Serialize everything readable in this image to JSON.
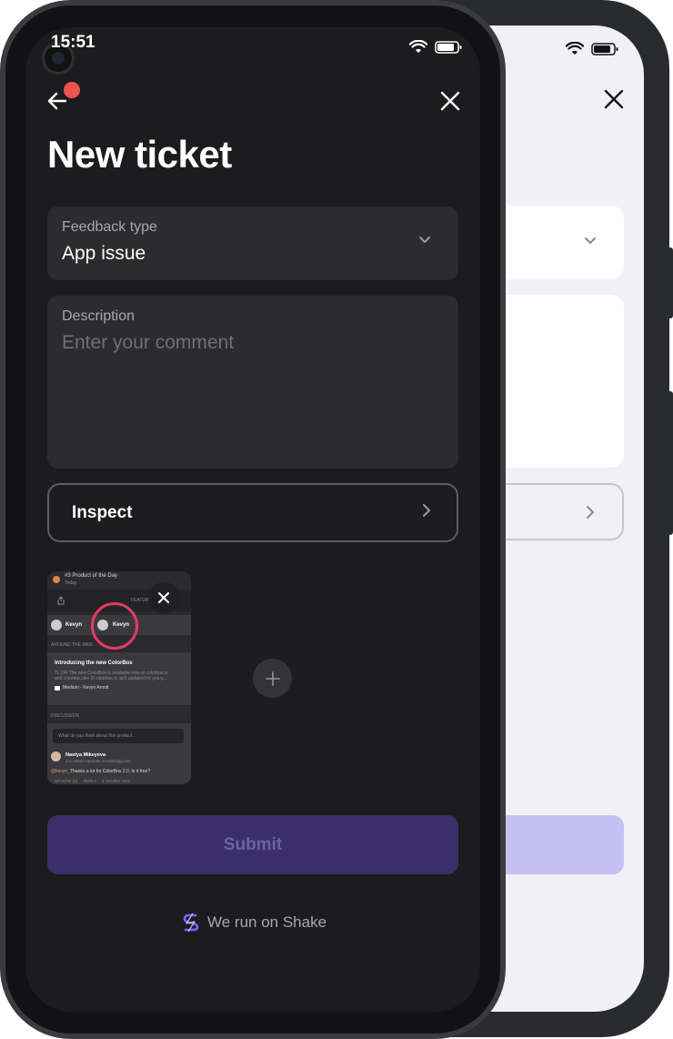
{
  "status": {
    "time": "15:51"
  },
  "header": {
    "title": "New ticket",
    "has_notification": true
  },
  "feedback_type": {
    "label": "Feedback type",
    "value": "App issue"
  },
  "description": {
    "label": "Description",
    "placeholder": "Enter your comment"
  },
  "inspect": {
    "label": "Inspect"
  },
  "attachment": {
    "product_rank": "#3 Product of the Day",
    "date": "Today",
    "featured_label": "FEATURED",
    "users": [
      "Kevyn",
      "Kevyn"
    ],
    "section_web": "AROUND THE WEB",
    "article_title": "Introducing the new ColorBox",
    "article_body_1": "TL;DR The new ColorBox is available now at colorbox.io",
    "article_body_2": "and colorbox.dev (if colorbox.io isn't updated for you y...",
    "article_source": "Medium - Kevyn Arnott",
    "section_discussion": "DISCUSSION",
    "discussion_placeholder": "What do you think about this product...",
    "commenter": "Nastya Mikeyeva",
    "commenter_role": "A Content marketer at Hashtag.com",
    "mention": "@kevyn_",
    "comment": "Thanks a lot for ColorBox 2.0. Is it free?",
    "actions": [
      "UPVOTE (1)",
      "REPLY",
      "4 HOURS AGO"
    ]
  },
  "submit": {
    "label": "Submit"
  },
  "footer": {
    "label": "We run on Shake"
  },
  "colors": {
    "background": "#1c1c1e",
    "field": "#2c2c2e",
    "submit_disabled": "#3a2f6b",
    "notification": "#ef5350",
    "highlight_ring": "#e53a68",
    "back_submit": "#c5c0f3"
  }
}
